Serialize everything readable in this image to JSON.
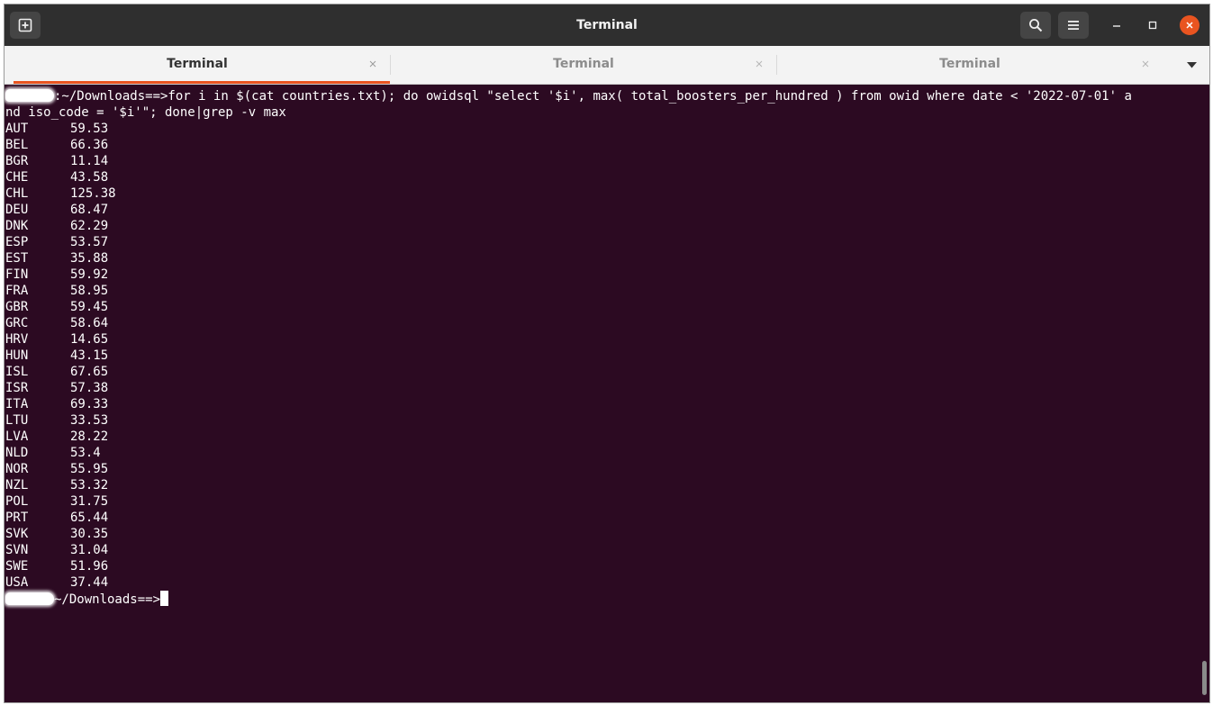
{
  "window": {
    "title": "Terminal",
    "buttons": {
      "new_tab": "new-tab-icon",
      "search": "search-icon",
      "menu": "hamburger-menu-icon",
      "minimize": "minimize-icon",
      "maximize": "maximize-icon",
      "close": "close-icon"
    }
  },
  "tabs": [
    {
      "label": "Terminal",
      "active": true
    },
    {
      "label": "Terminal",
      "active": false
    },
    {
      "label": "Terminal",
      "active": false
    }
  ],
  "terminal": {
    "command_line_1": ":~/Downloads==>for i in $(cat countries.txt); do owidsql \"select '$i', max( total_boosters_per_hundred ) from owid where date < '2022-07-01' a",
    "command_line_2": "nd iso_code = '$i'\"; done|grep -v max",
    "rows": [
      {
        "code": "AUT",
        "value": "59.53"
      },
      {
        "code": "BEL",
        "value": "66.36"
      },
      {
        "code": "BGR",
        "value": "11.14"
      },
      {
        "code": "CHE",
        "value": "43.58"
      },
      {
        "code": "CHL",
        "value": "125.38"
      },
      {
        "code": "DEU",
        "value": "68.47"
      },
      {
        "code": "DNK",
        "value": "62.29"
      },
      {
        "code": "ESP",
        "value": "53.57"
      },
      {
        "code": "EST",
        "value": "35.88"
      },
      {
        "code": "FIN",
        "value": "59.92"
      },
      {
        "code": "FRA",
        "value": "58.95"
      },
      {
        "code": "GBR",
        "value": "59.45"
      },
      {
        "code": "GRC",
        "value": "58.64"
      },
      {
        "code": "HRV",
        "value": "14.65"
      },
      {
        "code": "HUN",
        "value": "43.15"
      },
      {
        "code": "ISL",
        "value": "67.65"
      },
      {
        "code": "ISR",
        "value": "57.38"
      },
      {
        "code": "ITA",
        "value": "69.33"
      },
      {
        "code": "LTU",
        "value": "33.53"
      },
      {
        "code": "LVA",
        "value": "28.22"
      },
      {
        "code": "NLD",
        "value": "53.4"
      },
      {
        "code": "NOR",
        "value": "55.95"
      },
      {
        "code": "NZL",
        "value": "53.32"
      },
      {
        "code": "POL",
        "value": "31.75"
      },
      {
        "code": "PRT",
        "value": "65.44"
      },
      {
        "code": "SVK",
        "value": "30.35"
      },
      {
        "code": "SVN",
        "value": "31.04"
      },
      {
        "code": "SWE",
        "value": "51.96"
      },
      {
        "code": "USA",
        "value": "37.44"
      }
    ],
    "prompt": "~/Downloads==>"
  },
  "colors": {
    "terminal_bg": "#2c0a22",
    "accent": "#e95420",
    "headerbar": "#2f2f2f"
  }
}
